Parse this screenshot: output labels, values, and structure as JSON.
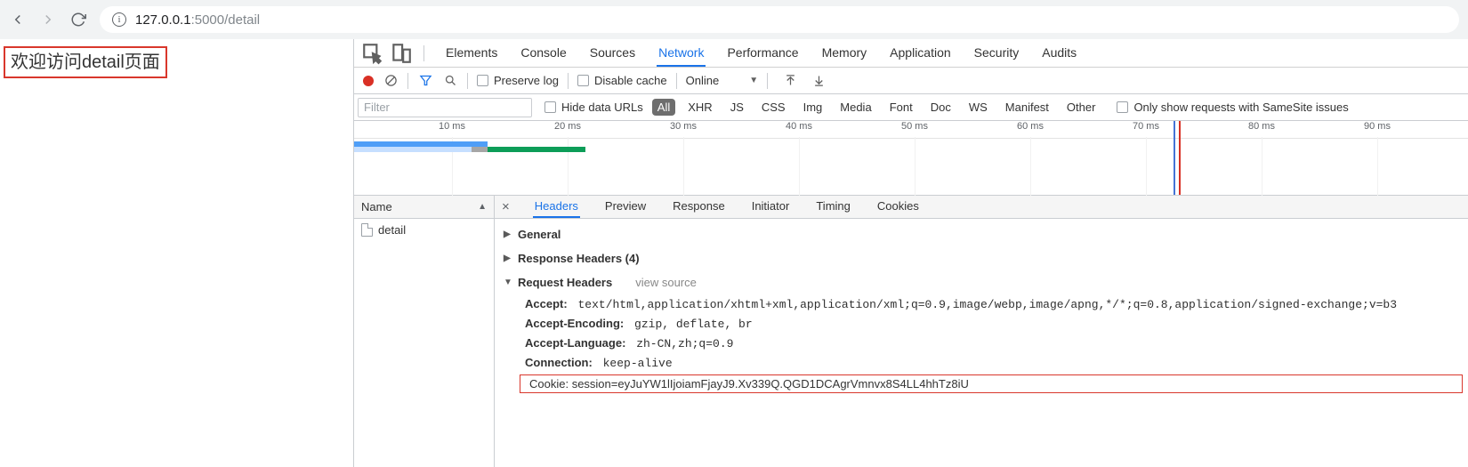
{
  "url": {
    "scheme_suffix": "127.0.0.1",
    "rest": ":5000/detail"
  },
  "page": {
    "welcome": "欢迎访问detail页面"
  },
  "devtools": {
    "tabs": [
      "Elements",
      "Console",
      "Sources",
      "Network",
      "Performance",
      "Memory",
      "Application",
      "Security",
      "Audits"
    ],
    "active_tab": "Network",
    "toolbar": {
      "preserve_log": "Preserve log",
      "disable_cache": "Disable cache",
      "throttle": "Online"
    },
    "filter": {
      "placeholder": "Filter",
      "hide_data_urls": "Hide data URLs",
      "types": [
        "All",
        "XHR",
        "JS",
        "CSS",
        "Img",
        "Media",
        "Font",
        "Doc",
        "WS",
        "Manifest",
        "Other"
      ],
      "active_type": "All",
      "samesite": "Only show requests with SameSite issues"
    },
    "timeline": {
      "ticks": [
        "10 ms",
        "20 ms",
        "30 ms",
        "40 ms",
        "50 ms",
        "60 ms",
        "70 ms",
        "80 ms",
        "90 ms"
      ]
    },
    "name_col": {
      "header": "Name",
      "items": [
        "detail"
      ]
    },
    "subtabs": [
      "Headers",
      "Preview",
      "Response",
      "Initiator",
      "Timing",
      "Cookies"
    ],
    "active_subtab": "Headers",
    "sections": {
      "general": "General",
      "response_headers": "Response Headers (4)",
      "request_headers": "Request Headers",
      "view_source": "view source"
    },
    "request_headers": [
      {
        "k": "Accept",
        "v": "text/html,application/xhtml+xml,application/xml;q=0.9,image/webp,image/apng,*/*;q=0.8,application/signed-exchange;v=b3"
      },
      {
        "k": "Accept-Encoding",
        "v": "gzip, deflate, br"
      },
      {
        "k": "Accept-Language",
        "v": "zh-CN,zh;q=0.9"
      },
      {
        "k": "Connection",
        "v": "keep-alive"
      },
      {
        "k": "Cookie",
        "v": "session=eyJuYW1lIjoiamFjayJ9.Xv339Q.QGD1DCAgrVmnvx8S4LL4hhTz8iU"
      }
    ]
  }
}
